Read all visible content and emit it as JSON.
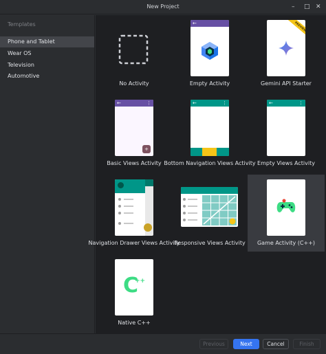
{
  "window": {
    "title": "New Project"
  },
  "sidebar": {
    "heading": "Templates",
    "items": [
      {
        "label": "Phone and Tablet"
      },
      {
        "label": "Wear OS"
      },
      {
        "label": "Television"
      },
      {
        "label": "Automotive"
      }
    ]
  },
  "templates": [
    {
      "label": "No Activity"
    },
    {
      "label": "Empty Activity"
    },
    {
      "label": "Gemini API Starter",
      "badge": "PREVIEW"
    },
    {
      "label": "Basic Views Activity"
    },
    {
      "label": "Bottom Navigation Views Activity"
    },
    {
      "label": "Empty Views Activity"
    },
    {
      "label": "Navigation Drawer Views Activity"
    },
    {
      "label": "Responsive Views Activity"
    },
    {
      "label": "Game Activity (C++)"
    },
    {
      "label": "Native C++"
    }
  ],
  "footer": {
    "previous": "Previous",
    "next": "Next",
    "cancel": "Cancel",
    "finish": "Finish"
  },
  "colors": {
    "accent": "#3574f0",
    "compose_purple": "#6750a4",
    "teal": "#009688",
    "amber": "#f5c518",
    "game_green": "#3ddc84"
  }
}
